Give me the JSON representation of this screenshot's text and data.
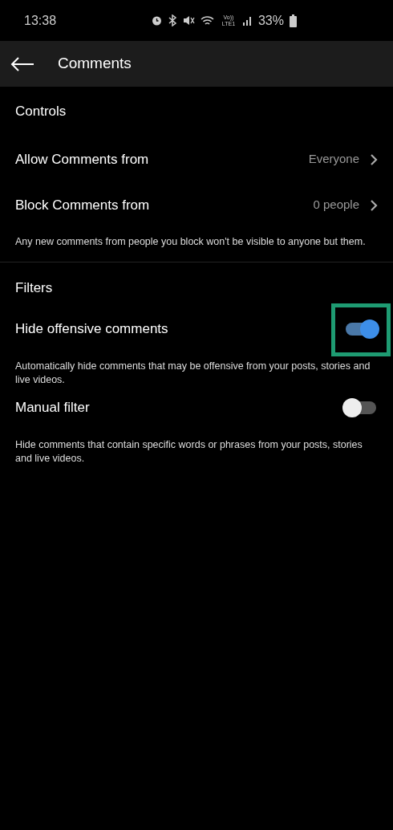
{
  "status_bar": {
    "time": "13:38",
    "network_label": "Vo)) LTE1",
    "battery": "33%"
  },
  "app_bar": {
    "title": "Comments"
  },
  "controls": {
    "heading": "Controls",
    "items": [
      {
        "label": "Allow Comments from",
        "value": "Everyone"
      },
      {
        "label": "Block Comments from",
        "value": "0 people"
      }
    ],
    "note": "Any new comments from people you block won't be visible to anyone but them."
  },
  "filters": {
    "heading": "Filters",
    "items": [
      {
        "label": "Hide offensive comments",
        "on": true,
        "highlighted": true,
        "description": "Automatically hide comments that may be offensive from your posts, stories and live videos."
      },
      {
        "label": "Manual filter",
        "on": false,
        "highlighted": false,
        "description": "Hide comments that contain specific words or phrases from your posts, stories and live videos."
      }
    ]
  }
}
